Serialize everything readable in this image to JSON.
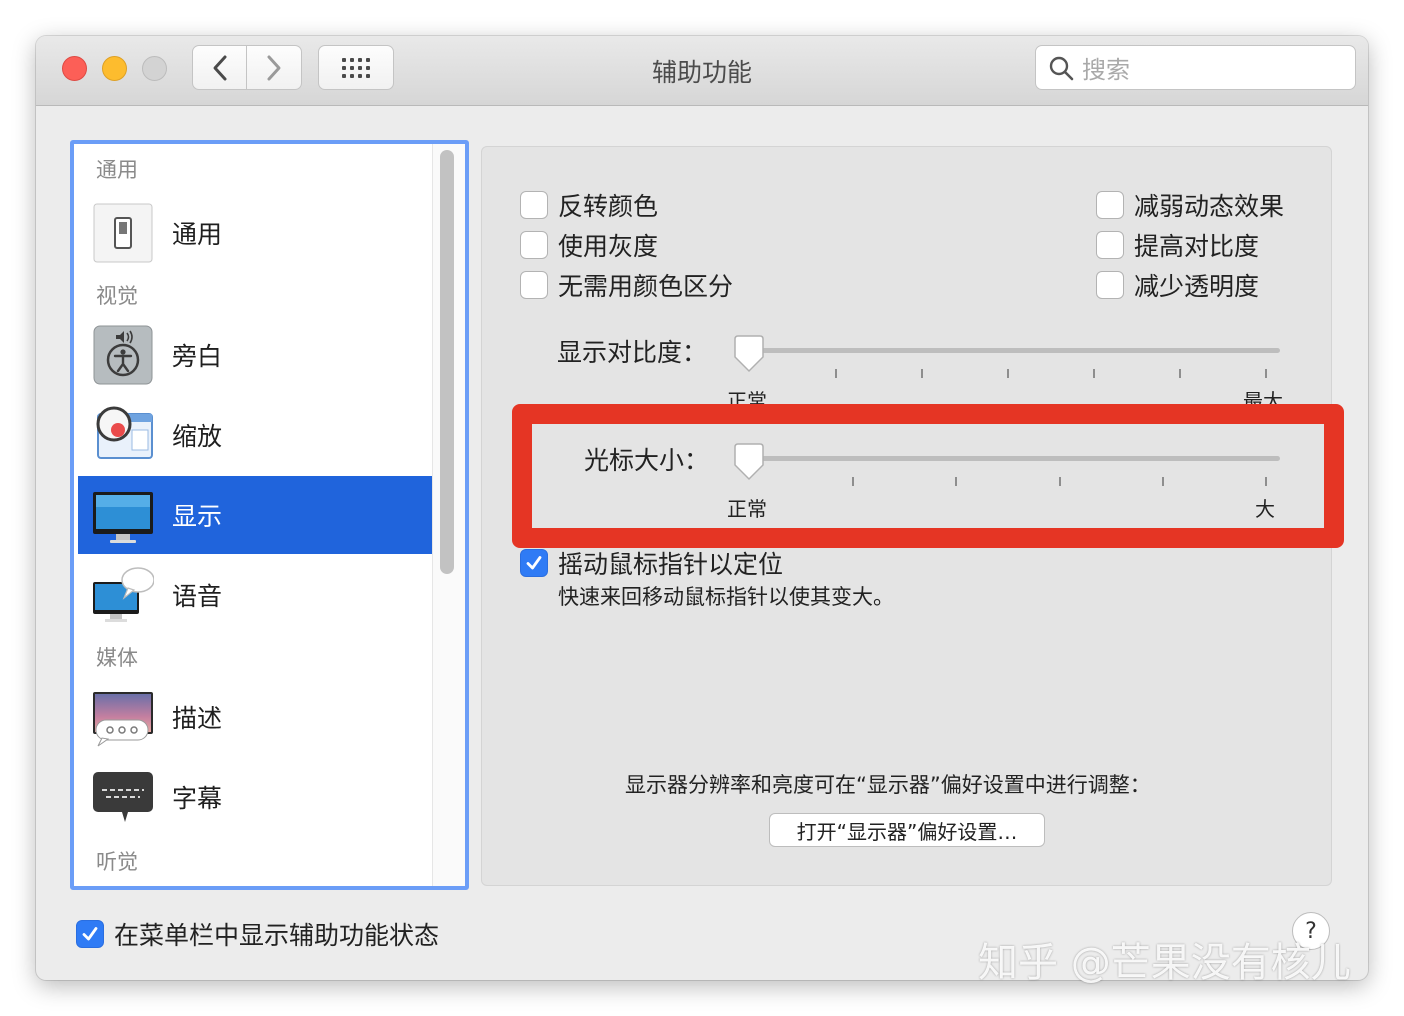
{
  "window": {
    "title": "辅助功能"
  },
  "toolbar": {
    "search_placeholder": "搜索"
  },
  "sidebar": {
    "sections": {
      "general": "通用",
      "vision": "视觉",
      "media": "媒体",
      "hearing": "听觉"
    },
    "items": [
      {
        "label": "通用",
        "icon": "general-switch-icon"
      },
      {
        "label": "旁白",
        "icon": "voiceover-icon"
      },
      {
        "label": "缩放",
        "icon": "zoom-icon"
      },
      {
        "label": "显示",
        "icon": "display-icon",
        "selected": true
      },
      {
        "label": "语音",
        "icon": "speech-icon"
      },
      {
        "label": "描述",
        "icon": "descriptions-icon"
      },
      {
        "label": "字幕",
        "icon": "captions-icon"
      }
    ]
  },
  "display": {
    "options_left": [
      {
        "label": "反转颜色",
        "checked": false
      },
      {
        "label": "使用灰度",
        "checked": false
      },
      {
        "label": "无需用颜色区分",
        "checked": false
      }
    ],
    "options_right": [
      {
        "label": "减弱动态效果",
        "checked": false
      },
      {
        "label": "提高对比度",
        "checked": false
      },
      {
        "label": "减少透明度",
        "checked": false
      }
    ],
    "contrast": {
      "label": "显示对比度：",
      "min_label": "正常",
      "max_label": "最大",
      "value_fraction": 0
    },
    "cursor_size": {
      "label": "光标大小：",
      "min_label": "正常",
      "max_label": "大",
      "value_fraction": 0
    },
    "shake_to_locate": {
      "label": "摇动鼠标指针以定位",
      "description": "快速来回移动鼠标指针以使其变大。",
      "checked": true
    },
    "display_prefs_hint": "显示器分辨率和亮度可在“显示器”偏好设置中进行调整：",
    "open_display_prefs_button": "打开“显示器”偏好设置…"
  },
  "footer": {
    "menubar_status": {
      "label": "在菜单栏中显示辅助功能状态",
      "checked": true
    },
    "help_label": "?"
  },
  "watermark": "知乎 @芒果没有核儿",
  "colors": {
    "accent": "#2064dc",
    "highlight_frame": "#e53524",
    "checkbox_checked": "#2f7bf5"
  }
}
